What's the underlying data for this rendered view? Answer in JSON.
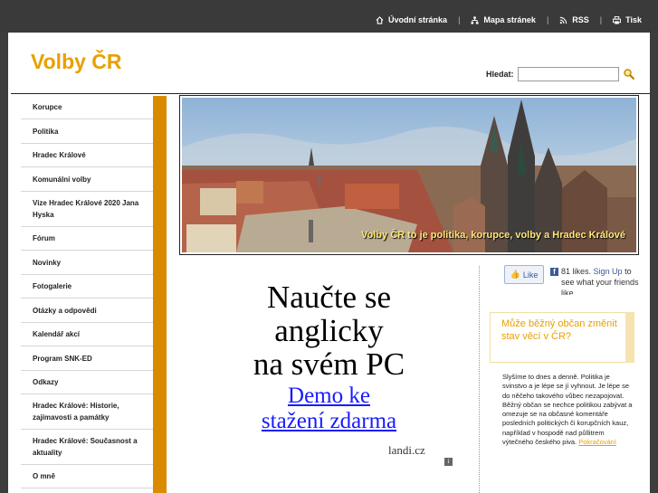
{
  "topnav": [
    {
      "label": "Úvodní stránka",
      "icon": "home-icon"
    },
    {
      "label": "Mapa stránek",
      "icon": "sitemap-icon"
    },
    {
      "label": "RSS",
      "icon": "rss-icon"
    },
    {
      "label": "Tisk",
      "icon": "print-icon"
    }
  ],
  "header": {
    "logo": "Volby ČR"
  },
  "search": {
    "label": "Hledat:",
    "value": ""
  },
  "menu": [
    {
      "label": "Korupce",
      "h": 26
    },
    {
      "label": "Politika",
      "h": 27
    },
    {
      "label": "Hradec Králové",
      "h": 26
    },
    {
      "label": "Komunální volby",
      "h": 27
    },
    {
      "label": "Vize Hradec Králové 2020 Jana Hyska",
      "h": 39
    },
    {
      "label": "Fórum",
      "h": 26
    },
    {
      "label": "Novinky",
      "h": 27
    },
    {
      "label": "Fotogalerie",
      "h": 26
    },
    {
      "label": "Otázky a odpovědi",
      "h": 27
    },
    {
      "label": "Kalendář akcí",
      "h": 26
    },
    {
      "label": "Program SNK-ED",
      "h": 27
    },
    {
      "label": "Odkazy",
      "h": 26
    },
    {
      "label": "Hradec Králové: Historie, zajímavosti a památky",
      "h": 39
    },
    {
      "label": "Hradec Králové: Současnost a aktuality",
      "h": 39
    },
    {
      "label": "O mně",
      "h": 26
    }
  ],
  "banner": {
    "caption": "Volby ČR to je politika, korupce, volby a Hradec Králové"
  },
  "ad": {
    "line1": "Naučte se",
    "line2": "anglicky",
    "line3": "na svém PC",
    "demo1": "Demo ke",
    "demo2": "stažení zdarma",
    "brand": "landi.cz"
  },
  "facebook": {
    "like_label": "Like",
    "count_text": "81 likes.",
    "signup_text": "Sign Up",
    "rest_text": "to see what your friends like."
  },
  "sidebar_box": {
    "title": "Může běžný občan změnit stav věcí v ČR?",
    "body": "Slyšíme to dnes a denně. Politika je svinstvo a je lépe se jí vyhnout. Je lépe se do něčeho takového vůbec nezapojovat. Běžný občan se nechce politikou zabývat a omezuje se na občasné komentáře posledních politických či korupčních kauz, například v hospodě nad půllitrem výtečného českého piva.",
    "more_link": "Pokračování"
  },
  "colors": {
    "accent": "#e8a000",
    "menu_bar": "#d98a00",
    "topbar": "#3a3a3a"
  }
}
